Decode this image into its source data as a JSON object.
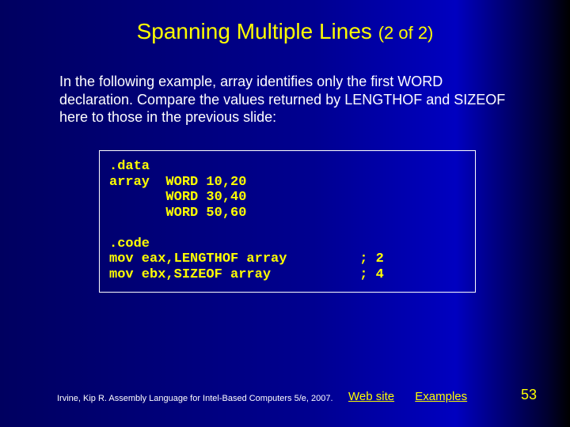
{
  "title": {
    "main": "Spanning Multiple Lines ",
    "sub": "(2 of 2)"
  },
  "body": "In the following example, array identifies only the first WORD declaration. Compare the values returned by LENGTHOF and SIZEOF here to those in the previous slide:",
  "code": ".data\narray  WORD 10,20\n       WORD 30,40\n       WORD 50,60\n\n.code\nmov eax,LENGTHOF array         ; 2\nmov ebx,SIZEOF array           ; 4",
  "footer": {
    "citation": "Irvine, Kip R. Assembly Language for Intel-Based Computers 5/e, 2007.",
    "link1": "Web site",
    "link2": "Examples",
    "page": "53"
  }
}
